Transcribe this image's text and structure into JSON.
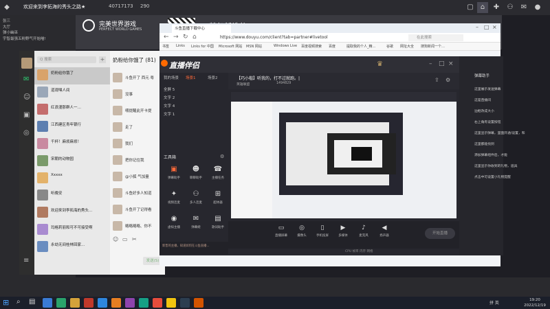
{
  "topbar": {
    "title": "欢迎来到李拓海的秀头之路★",
    "stat1": "40717173",
    "stat2": "290"
  },
  "leftchat": {
    "lines": [
      "张三",
      "大厅",
      "弹小幽巫",
      "宇智最强五粉野气开始喵!",
      "",
      "",
      "",
      "",
      "",
      "",
      "",
      "",
      "",
      "",
      "",
      "",
      "",
      "",
      "",
      "",
      "",
      "",
      "",
      "",
      "",
      "",
      "",
      "",
      "",
      "",
      "",
      "",
      "",
      "",
      "",
      "",
      "",
      "",
      "",
      "",
      "",
      "",
      "",
      "",
      ""
    ]
  },
  "banner": {
    "brand": "完美世界游戏",
    "brand_en": "PERFECT WORLD GAMES",
    "slogan": "梦幻新诛仙"
  },
  "wechat": {
    "search_placeholder": "Q 搜索",
    "items": [
      {
        "name": "奶粉给你饿了",
        "sub": "",
        "color": "#d9a36a"
      },
      {
        "name": "道观嘿人间",
        "sub": "",
        "color": "#9aa7b8"
      },
      {
        "name": "红浪漫那群人一…",
        "sub": "",
        "color": "#c46d6d"
      },
      {
        "name": "江西建区青年银行",
        "sub": "",
        "color": "#5d7fb0"
      },
      {
        "name": "千杯！麻烦麻烦！",
        "sub": "",
        "color": "#c98aa0"
      },
      {
        "name": "宋朝的动物园",
        "sub": "",
        "color": "#7a9a6a"
      },
      {
        "name": "Xxxxx",
        "sub": "",
        "color": "#e3b26a"
      },
      {
        "name": "听晚安",
        "sub": "",
        "color": "#888"
      },
      {
        "name": "欢迎来到李拓海的秀头…",
        "sub": "",
        "color": "#b07a60"
      },
      {
        "name": "玛格莉丽和可不可接受啊",
        "sub": "",
        "color": "#a98bd0"
      },
      {
        "name": "永劫无间桂林回家…",
        "sub": "",
        "color": "#6a8dc0"
      }
    ],
    "chat_title": "奶粉给你饿了 (81)",
    "messages": [
      "斗鱼开了 西元 粤",
      "没事",
      "喂提醒此开卡提",
      "走了",
      "我们",
      "把你记住我",
      "@小狐 气加量",
      "斗鱼好多人知道",
      "斗鱼开了记得看",
      "略略略略、你不"
    ],
    "send_label": "发送(S)"
  },
  "browser": {
    "tab_label": "斗鱼直播下载中心",
    "url": "https://www.douyu.com/client?tab=partner#livetool",
    "search_placeholder": "在此搜索",
    "bookmarks": [
      "书签",
      "Links",
      "Links for 中国",
      "Microsoft 网站",
      "MSN 网站",
      "Windows Live",
      "百度视频搜索",
      "百度",
      "提取我的个人_精…",
      "谷歌",
      "网址大全",
      "搜狗新闻一个…"
    ]
  },
  "douyu": {
    "app_name": "直播伴侣",
    "tabs": [
      "我的场景",
      "场景1",
      "场景2"
    ],
    "scenes": [
      "全屏 5",
      "文字 2",
      "文字 4",
      "文字 1"
    ],
    "tools_title": "工具箱",
    "tools": [
      {
        "icon": "▣",
        "label": "弹幕助手"
      },
      {
        "icon": "☻",
        "label": "聊聊助手"
      },
      {
        "icon": "☎",
        "label": "主播任务"
      },
      {
        "icon": "✦",
        "label": "视频连麦"
      },
      {
        "icon": "⚇",
        "label": "多人连麦"
      },
      {
        "icon": "⊞",
        "label": "超体器"
      },
      {
        "icon": "◉",
        "label": "虚拟主播"
      },
      {
        "icon": "✉",
        "label": "弹幕姬"
      },
      {
        "icon": "▤",
        "label": "歌词助手"
      }
    ],
    "notice": "新晋的主播，知道如何在斗鱼直播...",
    "room_title": "【巧小楷】听我的，打不过就跑。|",
    "room_meta_1": "英雄联盟",
    "room_meta_2": "1494829",
    "controls": [
      {
        "icon": "▭",
        "label": "直播屏幕"
      },
      {
        "icon": "◎",
        "label": "摄像头"
      },
      {
        "icon": "▯",
        "label": "手机投屏"
      },
      {
        "icon": "▶",
        "label": "多媒体"
      },
      {
        "icon": "♪",
        "label": "麦克风"
      },
      {
        "icon": "◀",
        "label": "扬声器"
      }
    ],
    "go_live": "开始直播",
    "footer": "CPU 帧率 内存 网络"
  },
  "rightpanel": {
    "title": "弹幕助手",
    "lines": [
      "这里展示发送弹幕",
      "这是直播间",
      "边框改成大小",
      "右上角有设置按钮",
      "这里显示弹幕，里面开通/设置，和",
      "这里都能找到",
      "添加弹幕组件后，才能",
      "这里显示你收到的礼物，道具",
      "点击中可设置小礼物提醒"
    ]
  },
  "taskbar": {
    "time": "19:20",
    "date": "2022/12/19",
    "ime": "拼 英",
    "app_colors": [
      "#3a7bd5",
      "#2aa36b",
      "#d4a23a",
      "#c0392b",
      "#2e86de",
      "#e67e22",
      "#8e44ad",
      "#16a085",
      "#e74c3c",
      "#f1c40f",
      "#2c3e50",
      "#d35400"
    ]
  }
}
